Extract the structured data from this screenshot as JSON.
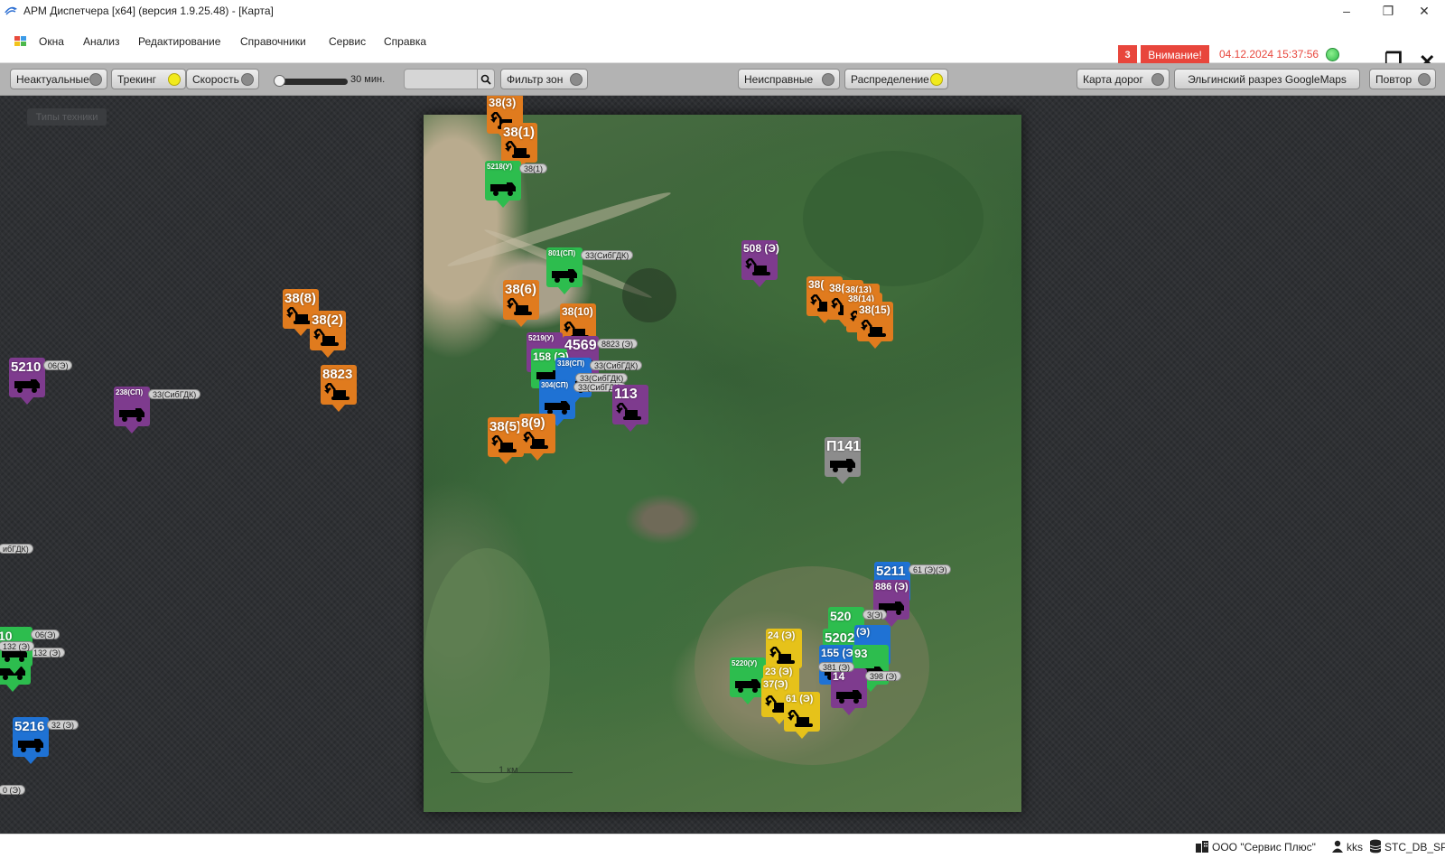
{
  "window": {
    "title": "АРМ Диспетчера [x64] (версия 1.9.25.48) - [Карта]"
  },
  "menu": [
    "Окна",
    "Анализ",
    "Редактирование",
    "Справочники",
    "Сервис",
    "Справка"
  ],
  "alerts": {
    "count": "3",
    "label": "Внимание!",
    "datetime": "04.12.2024 15:37:56"
  },
  "toolbar": {
    "nonactual": "Неактуальные",
    "tracking": "Трекинг",
    "speed": "Скорость",
    "period": "30 мин.",
    "zone_filter": "Фильтр зон",
    "faulty": "Неисправные",
    "distribution": "Распределение",
    "road_map": "Карта дорог",
    "google_maps": "Эльгинский разрез GoogleMaps",
    "repeat": "Повтор"
  },
  "workspace": {
    "types_button": "Типы техники",
    "map_scale": "1 км"
  },
  "colors": {
    "orange": "#e07b1e",
    "green": "#2dbd4e",
    "purple": "#7e3b8e",
    "blue": "#1f72d4",
    "gray": "#8c8c8c",
    "yellow": "#e6c21a"
  },
  "markers": [
    {
      "label": "38(3)",
      "color": "orange",
      "icon": "excavator-icon"
    },
    {
      "label": "38(1)",
      "color": "orange",
      "icon": "excavator-icon"
    },
    {
      "label": "5218(У)",
      "tag": "38(1)",
      "color": "green",
      "icon": "truck-icon"
    },
    {
      "label": "801(СП)",
      "tag": "33(СибГДК)",
      "color": "green",
      "icon": "truck-icon"
    },
    {
      "label": "508 (Э)",
      "color": "purple",
      "icon": "excavator-icon"
    },
    {
      "label": "38(",
      "color": "orange",
      "icon": "excavator-icon"
    },
    {
      "label": "38(",
      "color": "orange",
      "icon": "excavator-icon"
    },
    {
      "label": "38(13)",
      "color": "orange",
      "icon": "excavator-icon"
    },
    {
      "label": "38(14)",
      "color": "orange",
      "icon": "excavator-icon"
    },
    {
      "label": "38(15)",
      "color": "orange",
      "icon": "excavator-icon"
    },
    {
      "label": "38(6)",
      "color": "orange",
      "icon": "excavator-icon"
    },
    {
      "label": "38(10)",
      "color": "orange",
      "icon": "excavator-icon"
    },
    {
      "label": "5219(У)",
      "color": "purple",
      "icon": "truck-icon"
    },
    {
      "label": "4569",
      "tag": "8823 (Э)",
      "color": "purple",
      "icon": "truck-icon"
    },
    {
      "label": "158 (Э)",
      "color": "green",
      "icon": "truck-icon"
    },
    {
      "label": "318(СП)",
      "tag": "33(СибГДК)",
      "color": "blue",
      "icon": "truck-icon"
    },
    {
      "label": "304(СП)",
      "tag": "33(СибГДК)",
      "color": "blue",
      "icon": "truck-icon"
    },
    {
      "label": "113",
      "color": "purple",
      "icon": "excavator-icon"
    },
    {
      "label": "38(5)",
      "color": "orange",
      "icon": "excavator-icon"
    },
    {
      "label": "8(9)",
      "color": "orange",
      "icon": "excavator-icon"
    },
    {
      "label": "П141",
      "color": "gray",
      "icon": "truck-icon"
    },
    {
      "label": "38(8)",
      "color": "orange",
      "icon": "excavator-icon"
    },
    {
      "label": "38(2)",
      "color": "orange",
      "icon": "excavator-icon"
    },
    {
      "label": "8823",
      "color": "orange",
      "icon": "excavator-icon"
    },
    {
      "label": "5210",
      "tag": "06(Э)",
      "color": "purple",
      "icon": "truck-icon"
    },
    {
      "label": "238(СП)",
      "tag": "33(СибГДК)",
      "color": "purple",
      "icon": "truck-icon"
    },
    {
      "label": "5216",
      "tag": "32 (Э)",
      "color": "blue",
      "icon": "truck-icon"
    },
    {
      "label": "5211",
      "tag": "61 (Э)(Э)",
      "color": "blue",
      "icon": "truck-icon"
    },
    {
      "label": "886 (Э)",
      "color": "purple",
      "icon": "truck-icon"
    },
    {
      "label": "520",
      "tag": "3(Э)",
      "color": "green",
      "icon": "truck-icon"
    },
    {
      "label": "5202",
      "color": "green",
      "icon": "truck-icon"
    },
    {
      "label": "(Э)",
      "color": "blue",
      "icon": "truck-icon"
    },
    {
      "label": "155 (Э)",
      "tag": "61 (Э)",
      "color": "blue",
      "icon": "truck-icon"
    },
    {
      "label": "93",
      "color": "green",
      "icon": "truck-icon"
    },
    {
      "label": "5220(У)",
      "color": "green",
      "icon": "truck-icon"
    },
    {
      "label": "24 (Э)",
      "color": "yellow",
      "icon": "excavator-icon"
    },
    {
      "label": "23 (Э)",
      "color": "yellow",
      "icon": "excavator-icon"
    },
    {
      "label": "37(Э)",
      "color": "yellow",
      "icon": "excavator-icon"
    },
    {
      "label": "61 (Э)",
      "color": "yellow",
      "icon": "excavator-icon"
    },
    {
      "label": "14",
      "tag": "398 (Э)",
      "color": "purple",
      "icon": "truck-icon"
    },
    {
      "label": "2",
      "tag": "132 (Э)",
      "color": "green",
      "icon": "truck-icon"
    },
    {
      "label": "10",
      "tag": "06(Э)",
      "color": "green",
      "icon": "truck-icon"
    }
  ],
  "map_tags": [
    "ибГДК)",
    "132 (Э)",
    "0 (Э)",
    "33(СибГДК)",
    "381 (Э)"
  ],
  "statusbar": {
    "org": "ООО \"Сервис Плюс\"",
    "user": "kks",
    "db": "STC_DB_SP"
  }
}
